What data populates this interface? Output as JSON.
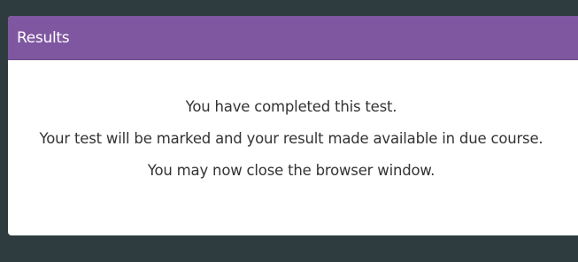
{
  "results": {
    "title": "Results",
    "messages": [
      "You have completed this test.",
      "Your test will be marked and your result made available in due course.",
      "You may now close the browser window."
    ]
  },
  "colors": {
    "header_bg": "#7f56a0",
    "page_bg": "#2f3c3f",
    "panel_bg": "#ffffff",
    "text": "#333333"
  }
}
